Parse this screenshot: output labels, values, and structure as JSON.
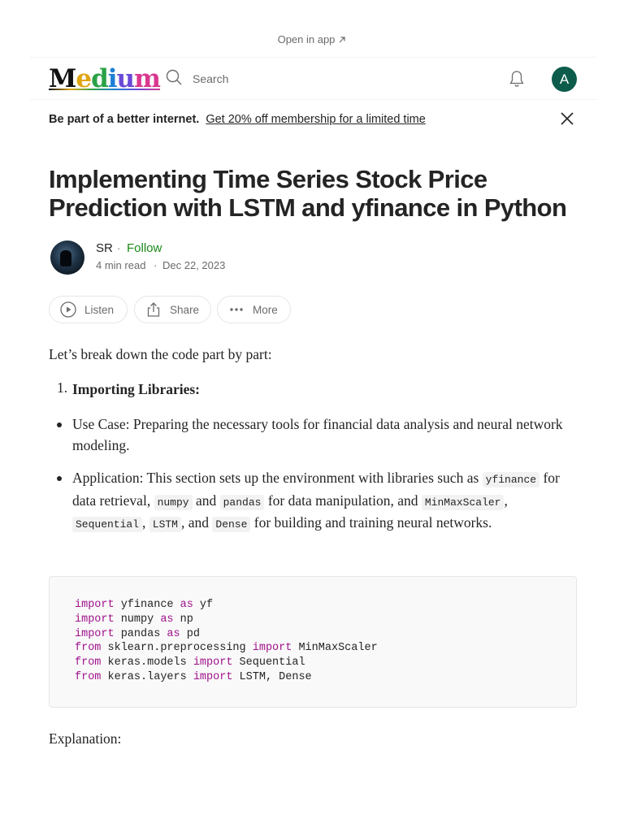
{
  "top_bar": {
    "open_in_app": "Open in app"
  },
  "header": {
    "logo_text": [
      "M",
      "e",
      "d",
      "i",
      "u",
      "m"
    ],
    "search_placeholder": "Search",
    "avatar_initial": "A"
  },
  "promo_banner": {
    "bold_text": "Be part of a better internet.",
    "link_text": "Get 20% off membership for a limited time"
  },
  "article": {
    "title": "Implementing Time Series Stock Price Prediction with LSTM and yfinance in Python",
    "author": {
      "name": "SR",
      "follow_label": "Follow",
      "read_time": "4 min read",
      "date": "Dec 22, 2023"
    },
    "actions": {
      "listen": "Listen",
      "share": "Share",
      "more": "More"
    },
    "intro": "Let’s break down the code part by part:",
    "section": {
      "number": "1.",
      "heading": "Importing Libraries:"
    },
    "bullets": {
      "use_case": "Use Case: Preparing the necessary tools for financial data analysis and neural network modeling.",
      "app_prefix": "Application: This section sets up the environment with libraries such as",
      "code_yfinance": "yfinance",
      "t_data_retrieval": "for data retrieval,",
      "code_numpy": "numpy",
      "t_and1": "and",
      "code_pandas": "pandas",
      "t_data_manip": "for data manipulation, and",
      "code_minmax": "MinMaxScaler",
      "code_sequential": "Sequential",
      "code_lstm": "LSTM",
      "t_and2": ", and",
      "code_dense": "Dense",
      "t_building": "for building and training neural networks."
    },
    "code_block": {
      "lines": [
        {
          "a": "import",
          "b": " yfinance ",
          "c": "as",
          "d": " yf"
        },
        {
          "a": "import",
          "b": " numpy ",
          "c": "as",
          "d": " np"
        },
        {
          "a": "import",
          "b": " pandas ",
          "c": "as",
          "d": " pd"
        },
        {
          "a": "from",
          "b": " sklearn.preprocessing ",
          "c": "import",
          "d": " MinMaxScaler"
        },
        {
          "a": "from",
          "b": " keras.models ",
          "c": "import",
          "d": " Sequential"
        },
        {
          "a": "from",
          "b": " keras.layers ",
          "c": "import",
          "d": " LSTM, Dense"
        }
      ]
    },
    "explanation_label": "Explanation:"
  },
  "colors": {
    "follow_green": "#1a8917",
    "avatar_bg": "#0d5c4b",
    "keyword": "#a0128c",
    "muted_text": "#6b6b6b"
  },
  "icons": [
    "arrow-up-right-icon",
    "search-icon",
    "bell-icon",
    "close-icon",
    "play-icon",
    "share-icon",
    "more-dots-icon"
  ]
}
